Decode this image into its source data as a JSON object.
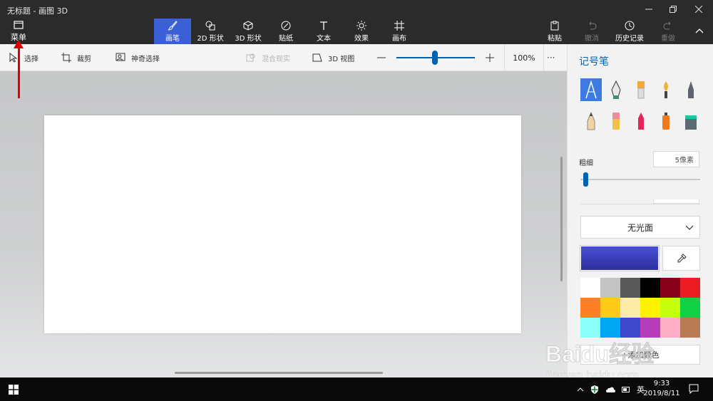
{
  "window": {
    "title": "无标题 - 画图 3D"
  },
  "menu": {
    "label": "菜单"
  },
  "tabs": [
    {
      "label": "画笔",
      "icon": "brush-icon",
      "active": true
    },
    {
      "label": "2D 形状",
      "icon": "2d-shapes-icon"
    },
    {
      "label": "3D 形状",
      "icon": "3d-shapes-icon"
    },
    {
      "label": "贴纸",
      "icon": "stickers-icon"
    },
    {
      "label": "文本",
      "icon": "text-icon"
    },
    {
      "label": "效果",
      "icon": "effects-icon"
    },
    {
      "label": "画布",
      "icon": "canvas-icon"
    }
  ],
  "right_actions": {
    "paste": "粘贴",
    "undo": "撤消",
    "history": "历史记录",
    "redo": "重做"
  },
  "toolbar": {
    "select": "选择",
    "crop": "裁剪",
    "magic_select": "神奇选择",
    "mixed_reality": "混合现实",
    "view_3d": "3D 视图",
    "zoom_level": "100%",
    "more": "···"
  },
  "panel": {
    "title": "记号笔",
    "thickness_label": "粗细",
    "thickness_value": "5像素",
    "finish": "无光面",
    "add_color": "+添加颜色",
    "current_color": "#3b3fc7",
    "palette": [
      "#ffffff",
      "#c3c3c3",
      "#585858",
      "#000000",
      "#88001b",
      "#ec1c24",
      "#ff7f27",
      "#ffca18",
      "#fdeca6",
      "#fff200",
      "#c4ff0e",
      "#0ed145",
      "#8cfffb",
      "#00a8f3",
      "#3f48cc",
      "#b83dba",
      "#ffaec8",
      "#b97a56"
    ]
  },
  "taskbar": {
    "ime": "英",
    "time": "9:33",
    "date": "2019/8/11"
  },
  "watermark": {
    "brand": "Baidu经验",
    "url": "jingyan.baidu.com"
  }
}
